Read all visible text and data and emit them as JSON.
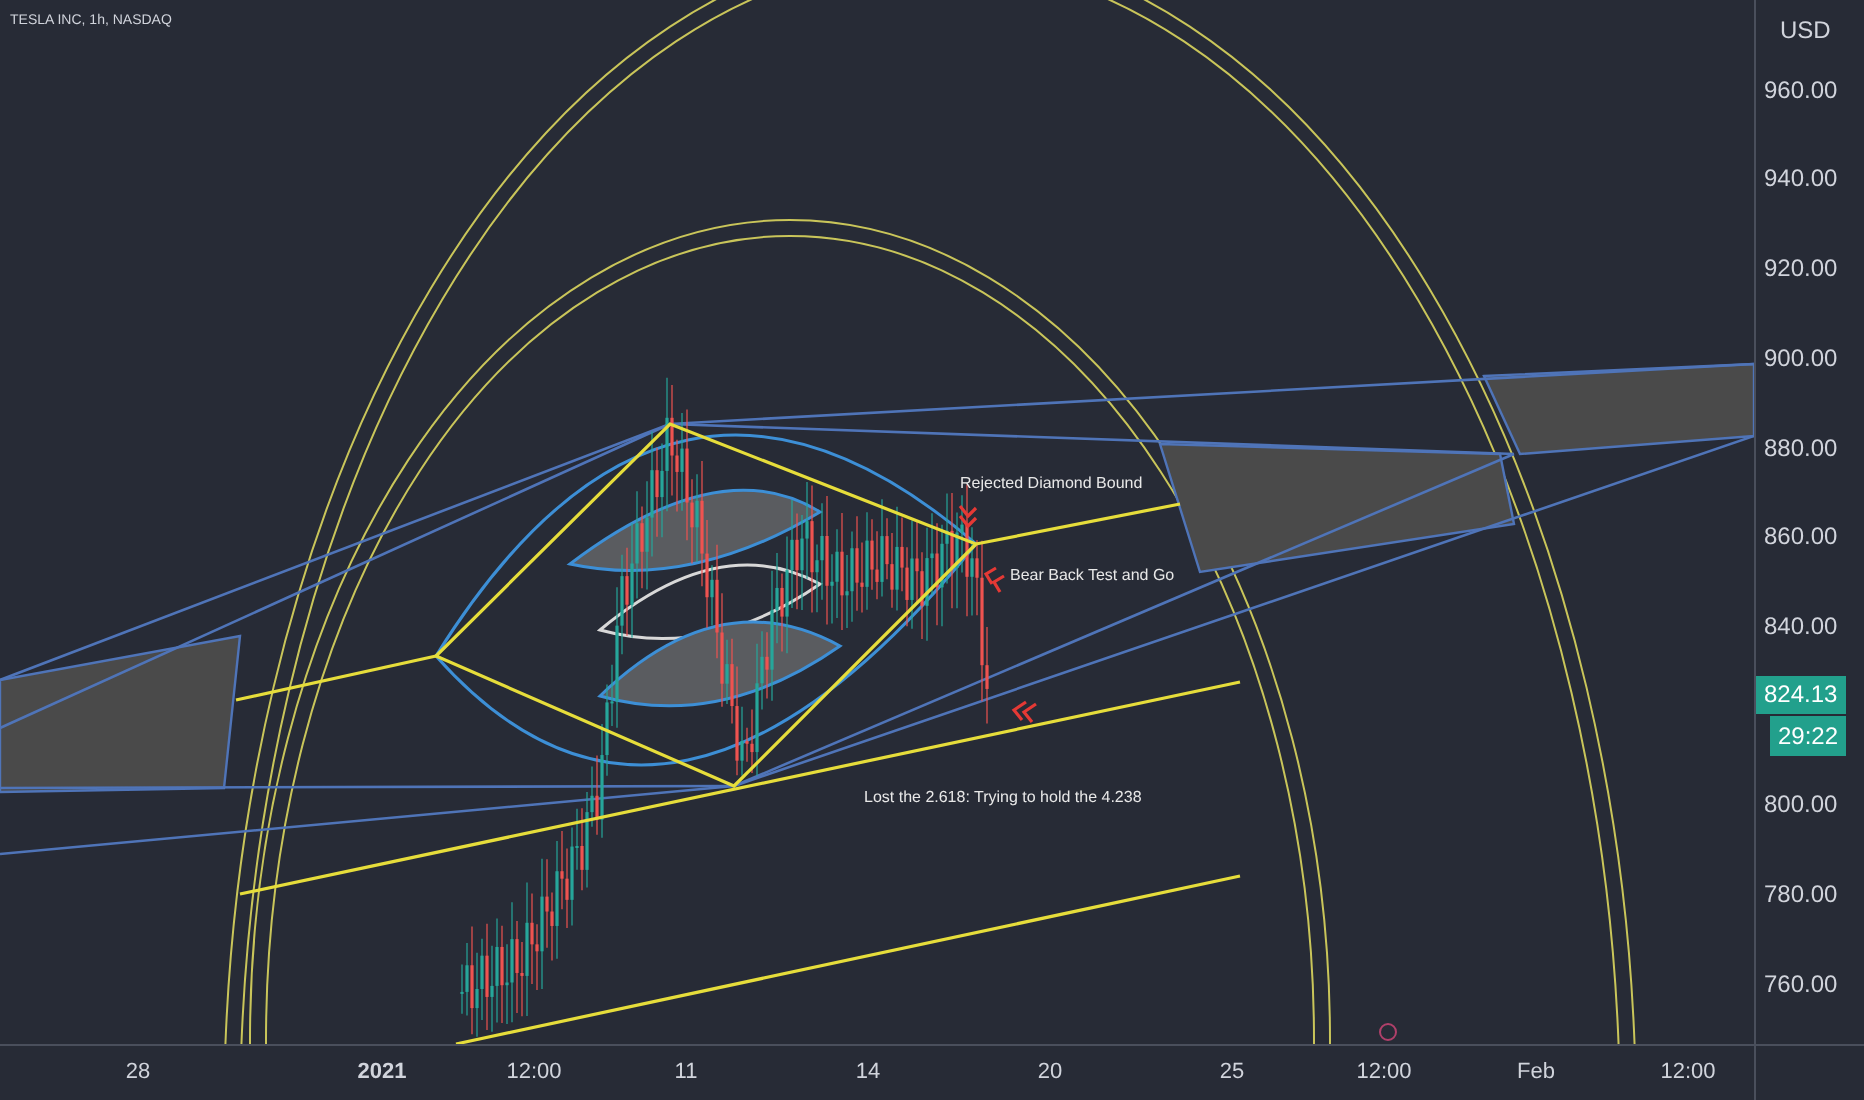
{
  "header": {
    "symbol_info": "TESLA INC, 1h, NASDAQ"
  },
  "annotations": [
    {
      "text": "Rejected Diamond Bound"
    },
    {
      "text": "Bear Back Test and Go"
    },
    {
      "text": "Lost the 2.618: Trying to hold the 4.238"
    }
  ],
  "price_axis": {
    "currency": "USD",
    "labels": [
      "960.00",
      "940.00",
      "920.00",
      "900.00",
      "880.00",
      "860.00",
      "840.00",
      "800.00",
      "780.00",
      "760.00"
    ],
    "last_price": "824.13",
    "countdown": "29:22"
  },
  "time_axis": {
    "labels": [
      {
        "text": "28",
        "bold": false
      },
      {
        "text": "2021",
        "bold": true
      },
      {
        "text": "12:00",
        "bold": false
      },
      {
        "text": "11",
        "bold": false
      },
      {
        "text": "14",
        "bold": false
      },
      {
        "text": "20",
        "bold": false
      },
      {
        "text": "25",
        "bold": false
      },
      {
        "text": "12:00",
        "bold": false
      },
      {
        "text": "Feb",
        "bold": false
      },
      {
        "text": "12:00",
        "bold": false
      }
    ]
  }
}
